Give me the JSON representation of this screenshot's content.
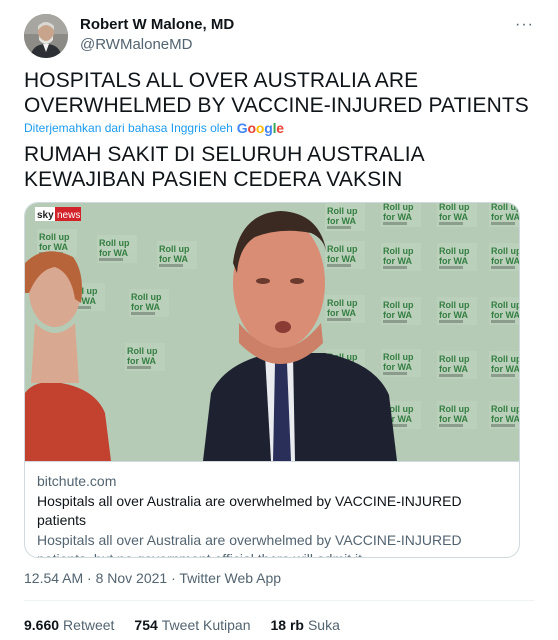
{
  "author": {
    "name": "Robert W Malone, MD",
    "handle": "@RWMaloneMD",
    "more_label": "···"
  },
  "tweet": {
    "text": "HOSPITALS ALL OVER AUSTRALIA ARE OVERWHELMED BY VACCINE-INJURED PATIENTS",
    "translation_notice": "Diterjemahkan dari bahasa Inggris oleh",
    "translation_provider": "Google",
    "translated_text": "RUMAH SAKIT DI SELURUH AUSTRALIA KEWAJIBAN PASIEN CEDERA VAKSIN"
  },
  "card": {
    "logo": "sky news",
    "banner_text": "Roll up for WA",
    "domain": "bitchute.com",
    "title": "Hospitals all over Australia are overwhelmed by VACCINE-INJURED patients",
    "description": "Hospitals all over Australia are overwhelmed by VACCINE-INJURED patients, but no government official there will admit it."
  },
  "meta": {
    "timestamp": "12.54 AM · 8 Nov 2021 · Twitter Web App"
  },
  "stats": [
    {
      "value": "9.660",
      "label": "Retweet"
    },
    {
      "value": "754",
      "label": "Tweet Kutipan"
    },
    {
      "value": "18 rb",
      "label": "Suka"
    }
  ],
  "colors": {
    "link": "#1d9bf0",
    "secondary_text": "#536471",
    "backdrop": "#b9cfba",
    "banner_green": "#2e7a3c"
  }
}
